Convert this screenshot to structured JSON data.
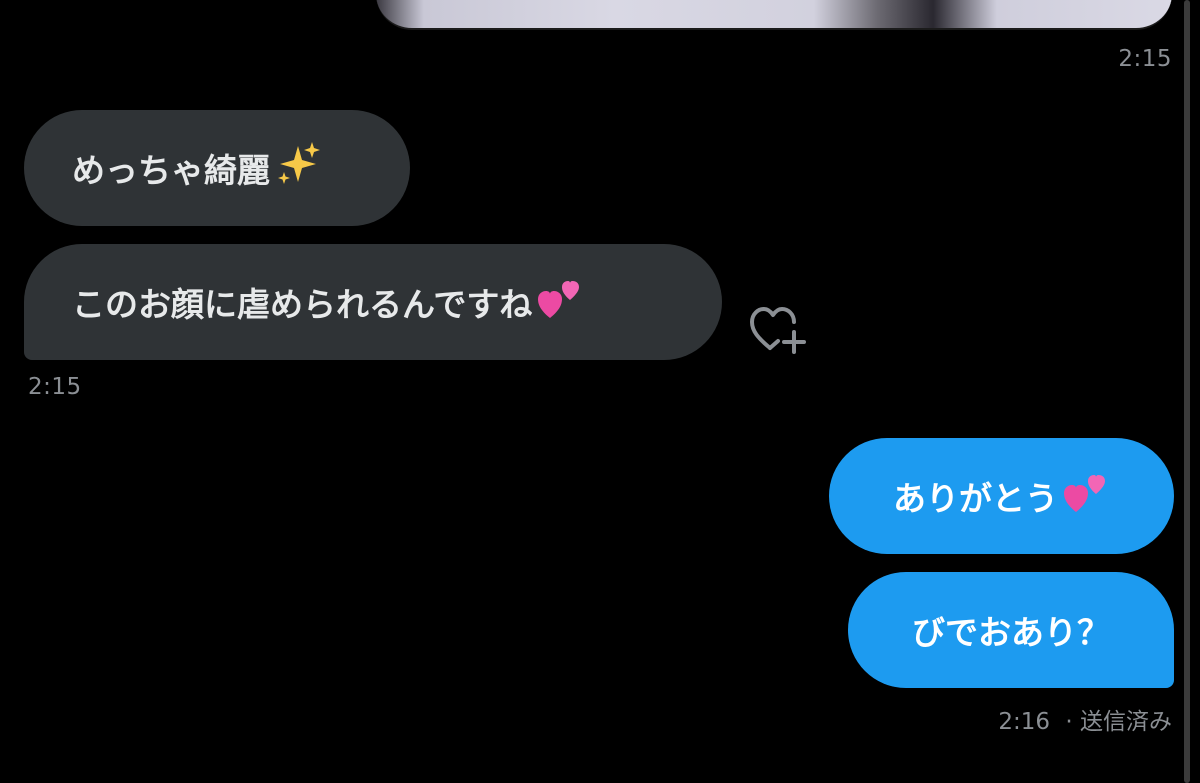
{
  "conversation": {
    "top_timestamp": "2:15",
    "messages": [
      {
        "direction": "received",
        "text": "めっちゃ綺麗",
        "emoji": "sparkles-icon"
      },
      {
        "direction": "received",
        "text": "このお顔に虐められるんですね",
        "emoji": "two-hearts-icon"
      },
      {
        "direction": "sent",
        "text": "ありがとう",
        "emoji": "two-hearts-icon"
      },
      {
        "direction": "sent",
        "text": "びでおあり？",
        "emoji": ""
      }
    ],
    "received_timestamp": "2:15",
    "sent_timestamp": "2:16",
    "sent_status": "· 送信済み"
  },
  "icons": {
    "react": "heart-plus-icon"
  },
  "colors": {
    "background": "#000000",
    "received_bubble": "#2f3336",
    "sent_bubble": "#1d9bf0",
    "timestamp": "#8b8f94",
    "received_text": "#e7e9ea",
    "sent_text": "#ffffff"
  }
}
